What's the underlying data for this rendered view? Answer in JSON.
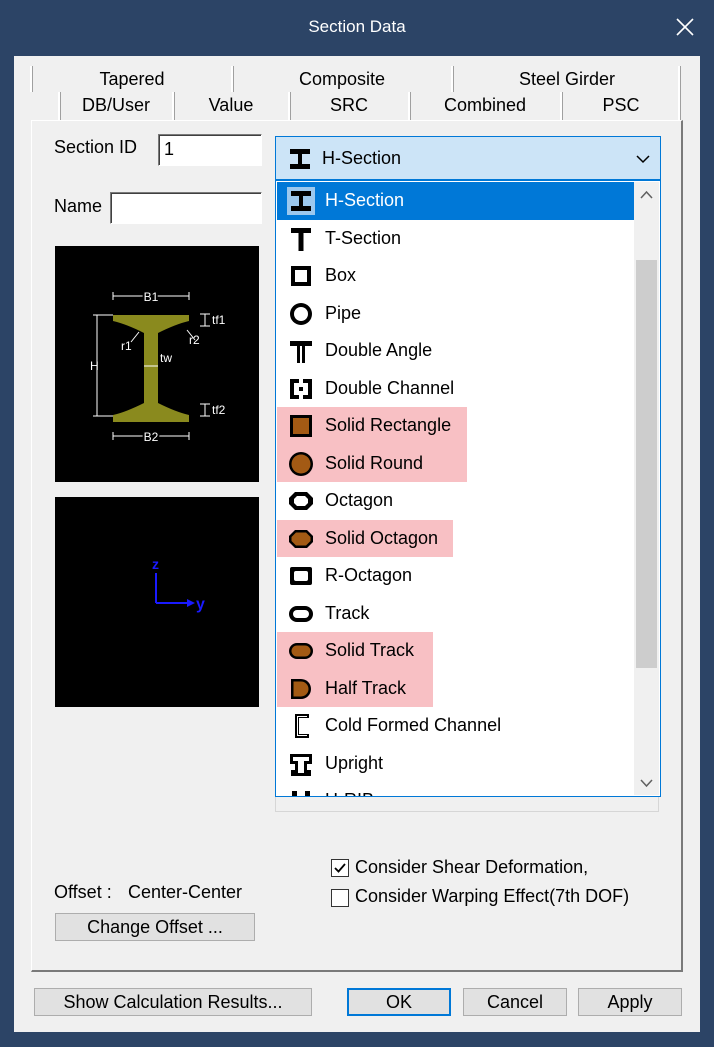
{
  "window": {
    "title": "Section Data"
  },
  "tabs": {
    "row1": [
      "Tapered",
      "Composite",
      "Steel Girder"
    ],
    "row2": [
      "DB/User",
      "Value",
      "SRC",
      "Combined",
      "PSC"
    ]
  },
  "form": {
    "section_id_label": "Section ID",
    "section_id_value": "1",
    "name_label": "Name",
    "name_value": ""
  },
  "combo": {
    "selected": "H-Section",
    "items": [
      {
        "label": "H-Section",
        "icon": "h-section-icon",
        "state": "selected"
      },
      {
        "label": "T-Section",
        "icon": "t-section-icon",
        "state": "normal"
      },
      {
        "label": "Box",
        "icon": "box-icon",
        "state": "normal"
      },
      {
        "label": "Pipe",
        "icon": "pipe-icon",
        "state": "normal"
      },
      {
        "label": "Double Angle",
        "icon": "double-angle-icon",
        "state": "normal"
      },
      {
        "label": "Double Channel",
        "icon": "double-channel-icon",
        "state": "normal"
      },
      {
        "label": "Solid Rectangle",
        "icon": "solid-rectangle-icon",
        "state": "highlighted"
      },
      {
        "label": "Solid Round",
        "icon": "solid-round-icon",
        "state": "highlighted"
      },
      {
        "label": "Octagon",
        "icon": "octagon-icon",
        "state": "normal"
      },
      {
        "label": "Solid Octagon",
        "icon": "solid-octagon-icon",
        "state": "highlighted"
      },
      {
        "label": "R-Octagon",
        "icon": "r-octagon-icon",
        "state": "normal"
      },
      {
        "label": "Track",
        "icon": "track-icon",
        "state": "normal"
      },
      {
        "label": "Solid Track",
        "icon": "solid-track-icon",
        "state": "highlighted"
      },
      {
        "label": "Half Track",
        "icon": "half-track-icon",
        "state": "highlighted"
      },
      {
        "label": "Cold Formed Channel",
        "icon": "cold-formed-channel-icon",
        "state": "normal"
      },
      {
        "label": "Upright",
        "icon": "upright-icon",
        "state": "normal"
      },
      {
        "label": "H-RIB",
        "icon": "h-rib-icon",
        "state": "partial"
      }
    ]
  },
  "diagram": {
    "labels": {
      "b1": "B1",
      "b2": "B2",
      "h": "H",
      "tf1": "tf1",
      "tf2": "tf2",
      "tw": "tw",
      "r1": "r1",
      "r2": "r2"
    },
    "axes": {
      "z": "z",
      "y": "y"
    }
  },
  "options": {
    "shear_label": "Consider Shear Deformation,",
    "shear_checked": true,
    "warping_label": "Consider Warping Effect(7th DOF)",
    "warping_checked": false
  },
  "offset": {
    "label": "Offset :",
    "value": "Center-Center",
    "change_button": "Change Offset ..."
  },
  "buttons": {
    "calc": "Show Calculation Results...",
    "ok": "OK",
    "cancel": "Cancel",
    "apply": "Apply"
  },
  "colors": {
    "accent": "#0078d7",
    "highlight": "#f8c0c4",
    "shape_fill": "#a35a14",
    "section_fill": "#8a8a1e",
    "axis": "#1a1aff"
  }
}
